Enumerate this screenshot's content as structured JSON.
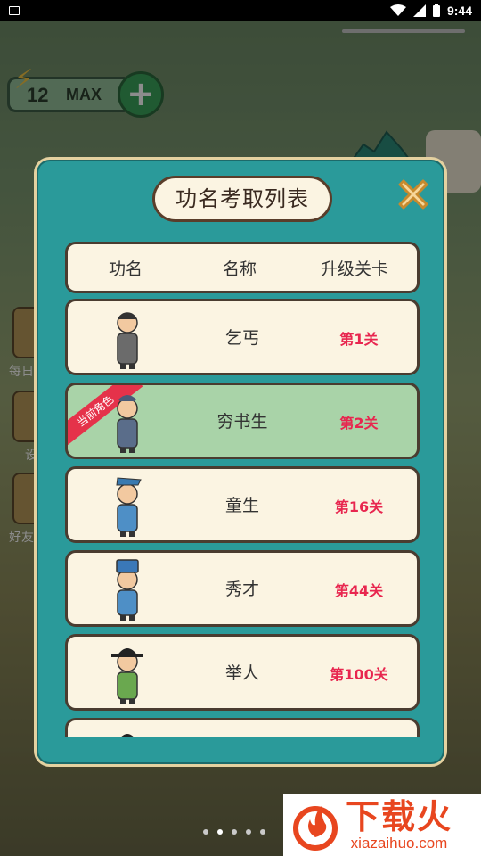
{
  "status_bar": {
    "time": "9:44"
  },
  "hud": {
    "energy_value": "12",
    "energy_max": "MAX"
  },
  "side_menu": [
    {
      "label": "每日"
    },
    {
      "label": "设"
    },
    {
      "label": "好友"
    }
  ],
  "modal": {
    "title": "功名考取列表",
    "columns": [
      "功名",
      "名称",
      "升级关卡"
    ],
    "current_badge": "当前角色",
    "rows": [
      {
        "name": "乞丐",
        "level": "第1关",
        "current": false,
        "robe_color": "#6b6b6b",
        "hat_color": "#333333"
      },
      {
        "name": "穷书生",
        "level": "第2关",
        "current": true,
        "robe_color": "#5a6d8a",
        "hat_color": "#4a5a78"
      },
      {
        "name": "童生",
        "level": "第16关",
        "current": false,
        "robe_color": "#4e8fc6",
        "hat_color": "#3a7ab0"
      },
      {
        "name": "秀才",
        "level": "第44关",
        "current": false,
        "robe_color": "#4e8fc6",
        "hat_color": "#3a78b8"
      },
      {
        "name": "举人",
        "level": "第100关",
        "current": false,
        "robe_color": "#6aa84f",
        "hat_color": "#222222"
      }
    ]
  },
  "page_indicator": {
    "count": 5,
    "active": 1
  },
  "watermark": {
    "cn": "下载火",
    "en": "xiazaihuo.com"
  }
}
